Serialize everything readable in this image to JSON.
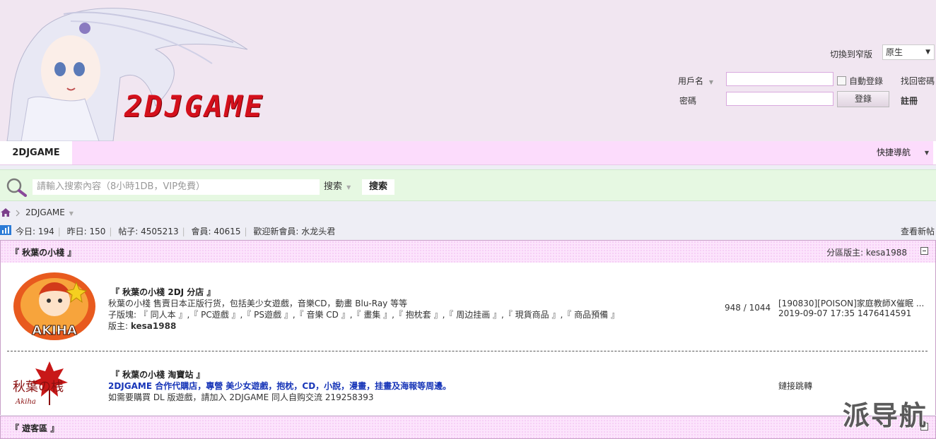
{
  "header": {
    "logo_text": "2DJGAME",
    "switch_label": "切換到窄版",
    "switch_value": "原生",
    "username_label": "用戶名",
    "auto_login_label": "自動登錄",
    "find_password_label": "找回密碼",
    "password_label": "密碼",
    "login_button": "登錄",
    "register_link": "註冊"
  },
  "nav": {
    "home": "2DJGAME",
    "quick_nav": "快捷導航"
  },
  "search": {
    "placeholder": "請輸入搜索內容（8小時1DB，VIP免費）",
    "type": "搜索",
    "button": "搜索"
  },
  "breadcrumb": {
    "item": "2DJGAME"
  },
  "stats": {
    "today": "今日: 194",
    "yesterday": "昨日: 150",
    "posts": "帖子: 4505213",
    "members": "會員: 40615",
    "welcome": "歡迎新會員: 水龙头君",
    "new_posts": "查看新帖"
  },
  "categories": [
    {
      "title": "『 秋葉の小棧 』",
      "moderator": "分區版主: kesa1988",
      "forums": [
        {
          "title": "『 秋葉の小棧 2DJ 分店 』",
          "desc": "秋葉の小棧 售賣日本正版行货，包括美少女遊戲，音樂CD，動畫 Blu-Ray 等等",
          "subforums": "子版塊: 『 同人本 』,『 PC遊戲 』,『 PS遊戲 』,『 音樂 CD 』,『 畫集 』,『 抱枕套 』,『 周边挂画 』,『 現貨商品 』,『 商品預備 』",
          "moderator_label": "版主: ",
          "moderator": "kesa1988",
          "counts": "948 / 1044",
          "last_post": "[190830][POISON]家庭教師X催眠 ...",
          "last_post_meta": "2019-09-07 17:35 1476414591",
          "icon_text": "AKIHA"
        },
        {
          "title": "『 秋葉の小棧 淘寶站 』",
          "highlight": "2DJGAME 合作代購店，專營 美少女遊戲，抱枕，CD，小說，漫畫，挂畫及海報等周邊。",
          "desc": "如需要購買 DL 版遊戲，請加入 2DJGAME 同人自购交流 219258393",
          "link_redirect": "鏈接跳轉",
          "icon_text": "秋葉の桟",
          "icon_sub": "Akiha"
        }
      ]
    },
    {
      "title": "『 遊客區 』"
    }
  ],
  "watermark": "派导航",
  "colors": {
    "header_bg": "#f1e6f1",
    "nav_bg": "#fcdcfc",
    "search_bg": "#e6f8e2",
    "logo_red": "#d4101c",
    "link_blue": "#1836b8"
  }
}
